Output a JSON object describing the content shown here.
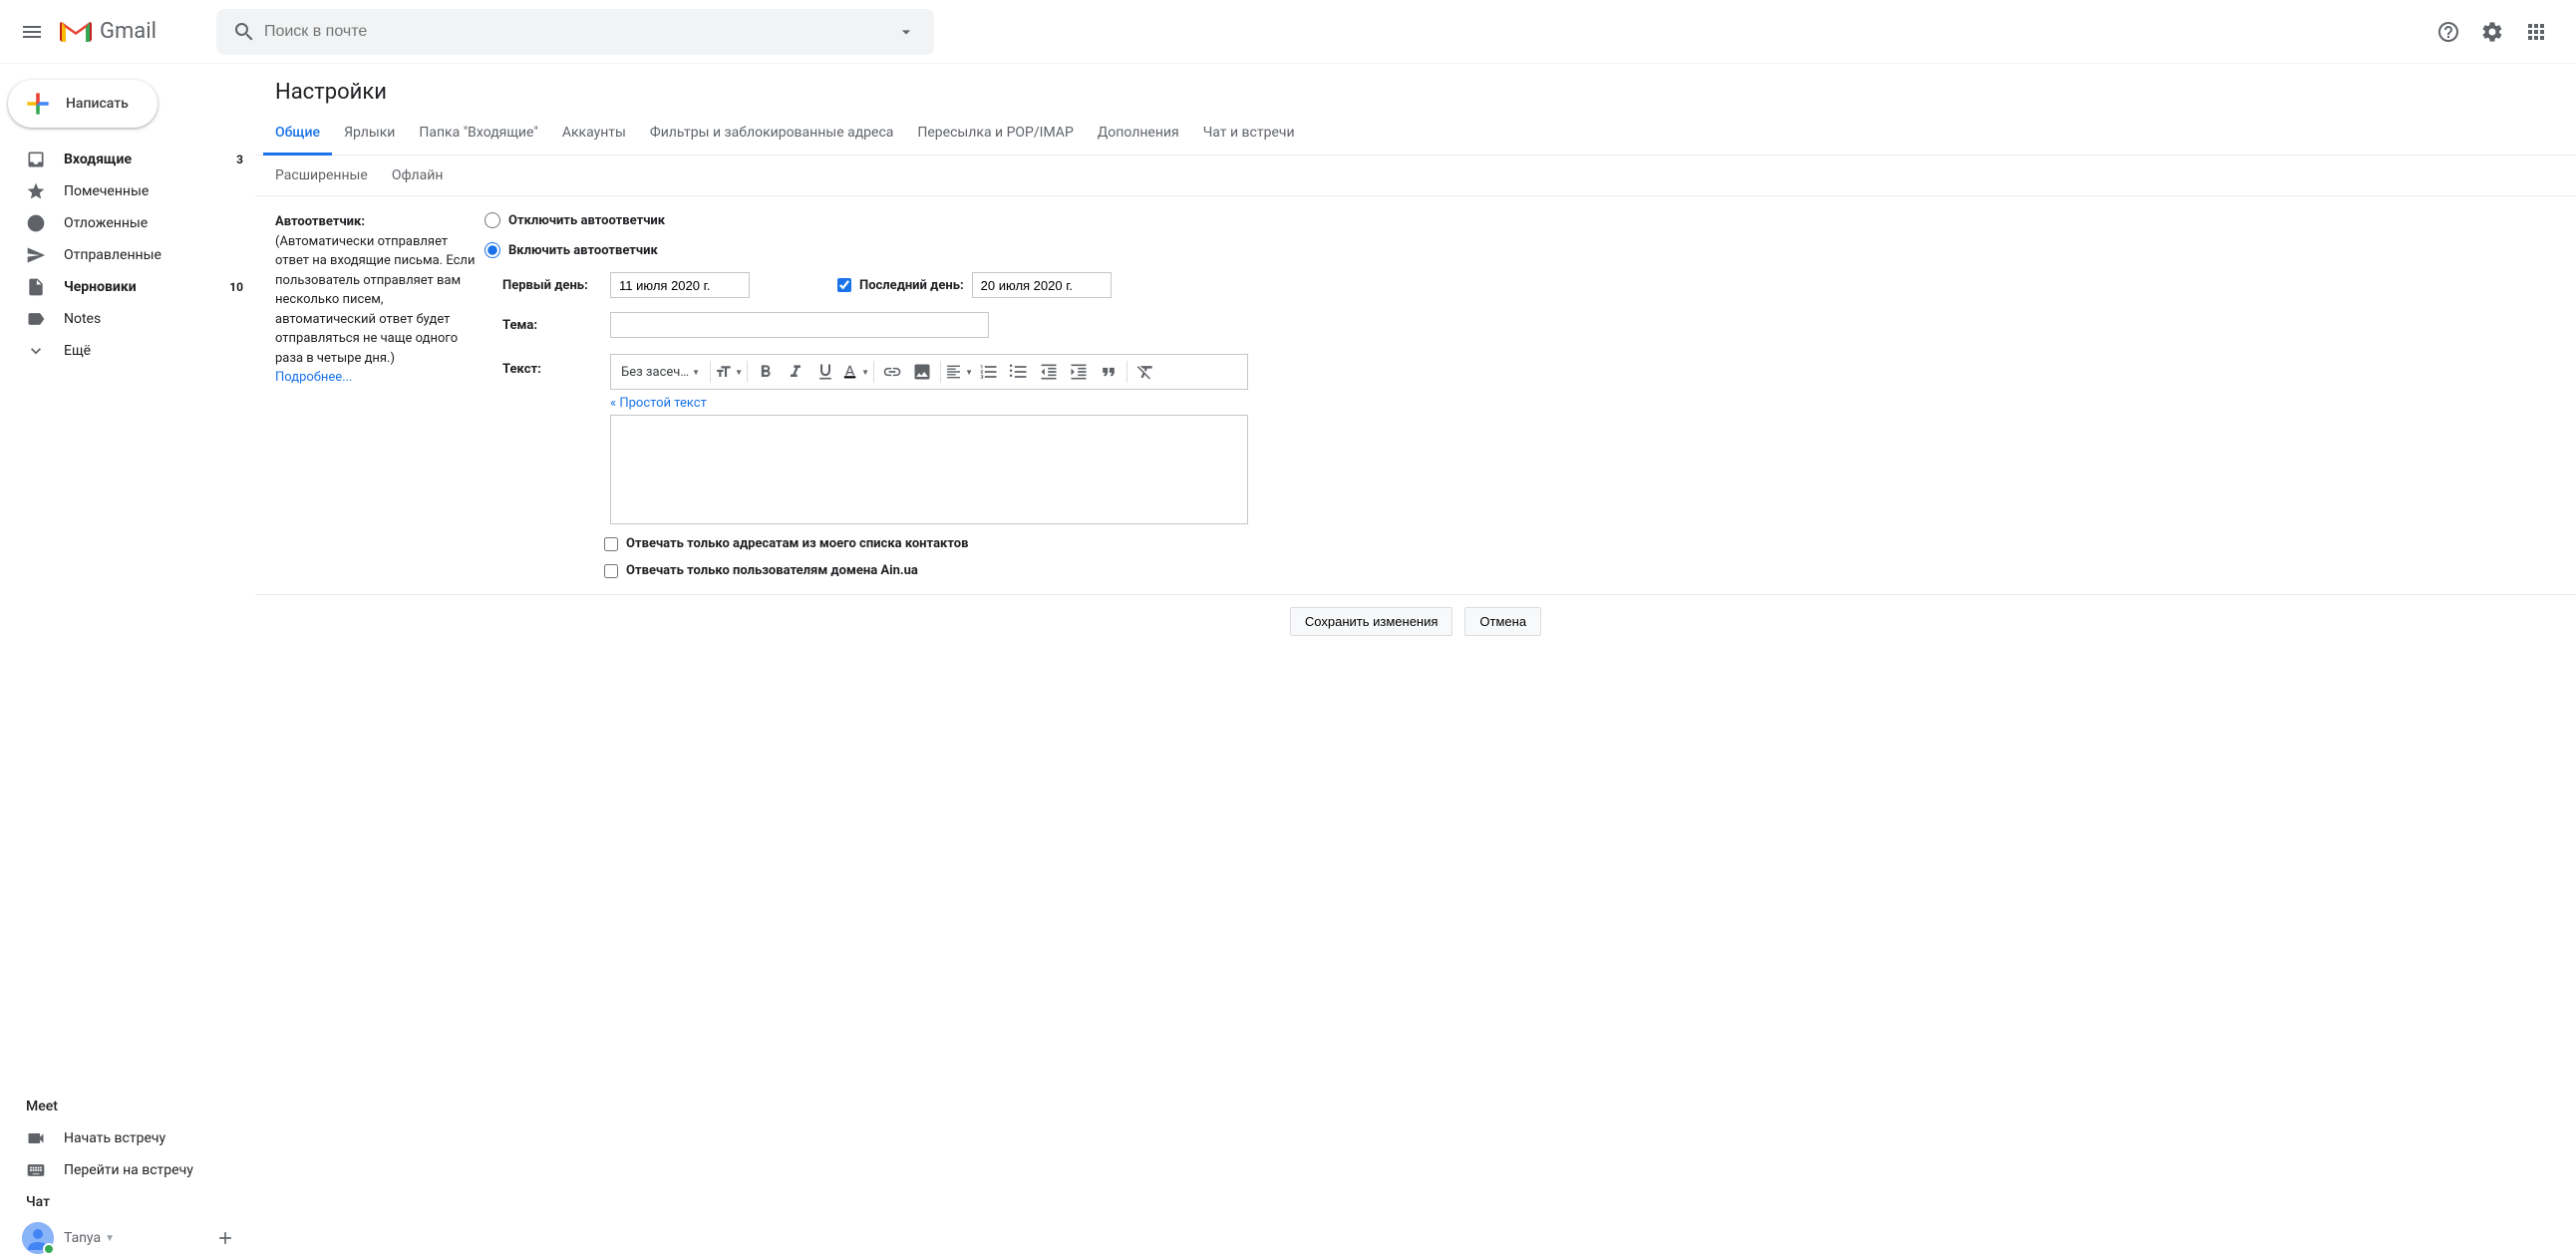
{
  "header": {
    "app_name": "Gmail",
    "search_placeholder": "Поиск в почте"
  },
  "compose_label": "Написать",
  "nav": [
    {
      "icon": "inbox",
      "label": "Входящие",
      "count": "3",
      "bold": true
    },
    {
      "icon": "star",
      "label": "Помеченные",
      "count": "",
      "bold": false
    },
    {
      "icon": "clock",
      "label": "Отложенные",
      "count": "",
      "bold": false
    },
    {
      "icon": "send",
      "label": "Отправленные",
      "count": "",
      "bold": false
    },
    {
      "icon": "file",
      "label": "Черновики",
      "count": "10",
      "bold": true
    },
    {
      "icon": "label",
      "label": "Notes",
      "count": "",
      "bold": false
    },
    {
      "icon": "chevron",
      "label": "Ещё",
      "count": "",
      "bold": false
    }
  ],
  "meet_title": "Meet",
  "meet_items": [
    {
      "icon": "video",
      "label": "Начать встречу"
    },
    {
      "icon": "keyboard",
      "label": "Перейти на встречу"
    }
  ],
  "chat_title": "Чат",
  "chat_user": "Tanya",
  "page_title": "Настройки",
  "tabs_row1": [
    "Общие",
    "Ярлыки",
    "Папка \"Входящие\"",
    "Аккаунты",
    "Фильтры и заблокированные адреса",
    "Пересылка и POP/IMAP",
    "Дополнения",
    "Чат и встречи"
  ],
  "tabs_row2": [
    "Расширенные",
    "Офлайн"
  ],
  "active_tab": "Общие",
  "setting": {
    "title": "Автоответчик:",
    "desc": "(Автоматически отправляет ответ на входящие письма. Если пользователь отправляет вам несколько писем, автоматический ответ будет отправляться не чаще одного раза в четыре дня.)",
    "learn_more": "Подробнее...",
    "radio_off": "Отключить автоответчик",
    "radio_on": "Включить автоответчик",
    "first_day_label": "Первый день:",
    "first_day_value": "11 июля 2020 г.",
    "last_day_label": "Последний день:",
    "last_day_value": "20 июля 2020 г.",
    "subject_label": "Тема:",
    "text_label": "Текст:",
    "font_label": "Без засеч…",
    "plain_text_link": "« Простой текст",
    "chk_contacts": "Отвечать только адресатам из моего списка контактов",
    "chk_domain": "Отвечать только пользователям домена Ain.ua"
  },
  "footer": {
    "save": "Сохранить изменения",
    "cancel": "Отмена"
  }
}
